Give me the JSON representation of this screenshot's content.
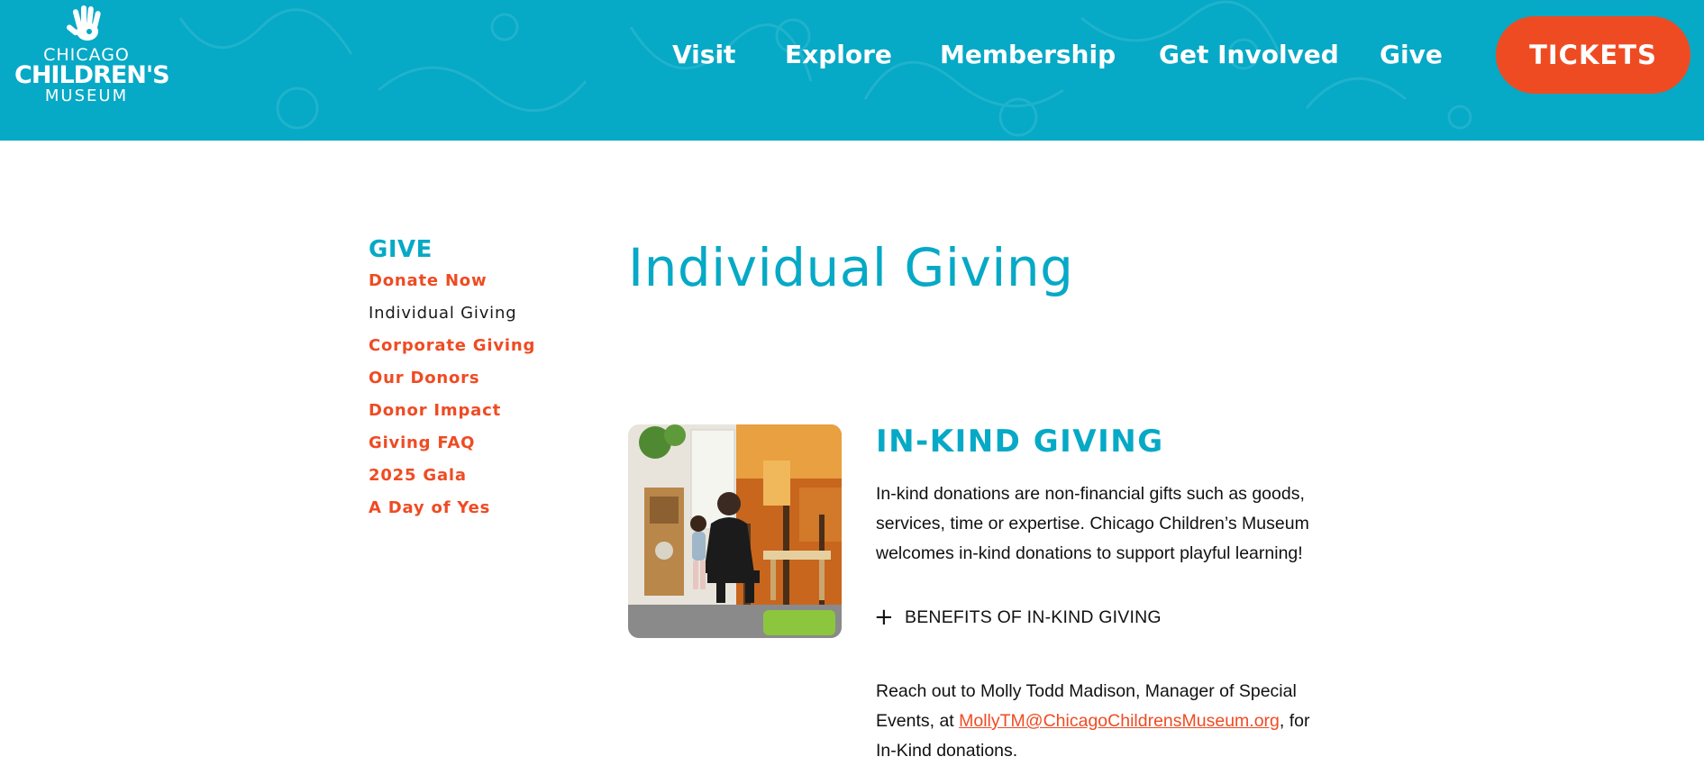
{
  "header": {
    "logo": {
      "line1": "CHICAGO",
      "line2": "CHILDREN'S",
      "line3": "MUSEUM"
    },
    "nav": [
      {
        "label": "Visit"
      },
      {
        "label": "Explore"
      },
      {
        "label": "Membership"
      },
      {
        "label": "Get Involved"
      },
      {
        "label": "Give"
      }
    ],
    "tickets_label": "TICKETS",
    "colors": {
      "background": "#06a9c6",
      "tickets": "#ef4b23"
    }
  },
  "sidebar": {
    "title": "GIVE",
    "items": [
      {
        "label": "Donate Now"
      },
      {
        "label": "Individual Giving",
        "active": true
      },
      {
        "label": "Corporate Giving"
      },
      {
        "label": "Our Donors"
      },
      {
        "label": "Donor Impact"
      },
      {
        "label": "Giving FAQ"
      },
      {
        "label": "2025 Gala"
      },
      {
        "label": "A Day of Yes"
      }
    ]
  },
  "main": {
    "title": "Individual Giving",
    "section": {
      "heading": "IN-KIND GIVING",
      "intro": "In-kind donations are non-financial gifts such as goods, services, time or expertise. Chicago Children’s Museum welcomes in-kind donations to support playful learning!",
      "accordion_label": "BENEFITS OF IN-KIND GIVING",
      "contact_before": "Reach out to Molly Todd Madison, Manager of Special Events, at ",
      "contact_email": "MollyTM@ChicagoChildrensMuseum.org",
      "contact_after": ", for In-Kind donations."
    }
  }
}
